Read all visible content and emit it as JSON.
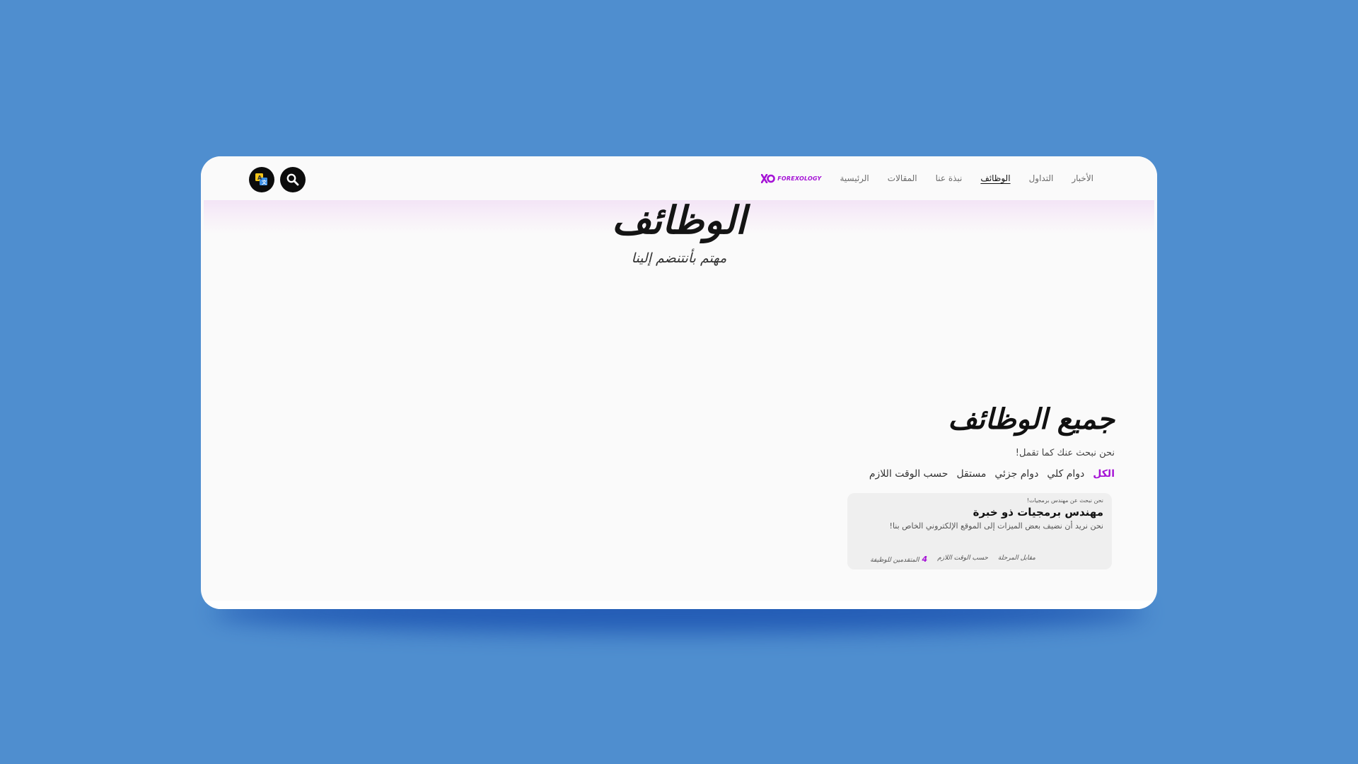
{
  "colors": {
    "background": "#4f8ecf",
    "accent": "#a513d6",
    "card": "#efefef"
  },
  "header": {
    "brand_name": "FOREXOLOGY",
    "nav": [
      {
        "label": "الرئيسية",
        "active": false
      },
      {
        "label": "المقالات",
        "active": false
      },
      {
        "label": "نبذة عنا",
        "active": false
      },
      {
        "label": "الوظائف",
        "active": true
      },
      {
        "label": "التداول",
        "active": false
      },
      {
        "label": "الأخبار",
        "active": false
      }
    ],
    "icons": {
      "search": "search-icon",
      "translate": "translate-icon"
    }
  },
  "hero": {
    "title": "الوظائف",
    "subtitle": "مهتم بأنتنضم إلينا"
  },
  "jobs": {
    "title": "جميع الوظائف",
    "subtitle": "نحن نبحث عنك كما تقمل!",
    "filters": [
      {
        "label": "الكل",
        "active": true
      },
      {
        "label": "دوام كلي",
        "active": false
      },
      {
        "label": "دوام جزئي",
        "active": false
      },
      {
        "label": "مستقل",
        "active": false
      },
      {
        "label": "حسب الوقت اللازم",
        "active": false
      }
    ],
    "listings": [
      {
        "kicker": "نحن نبحث عن مهندس برمجيات!",
        "title": "مهندس برمجيات ذو خبرة",
        "description": "نحن نريد أن نضيف بعض الميزات إلى الموقع الإلكتروني الخاص بنا!",
        "stage": "مقابل المرحلة",
        "schedule": "حسب الوقت اللازم",
        "applicants_count": "4",
        "applicants_label": "المتقدمين للوظيفة"
      }
    ]
  }
}
